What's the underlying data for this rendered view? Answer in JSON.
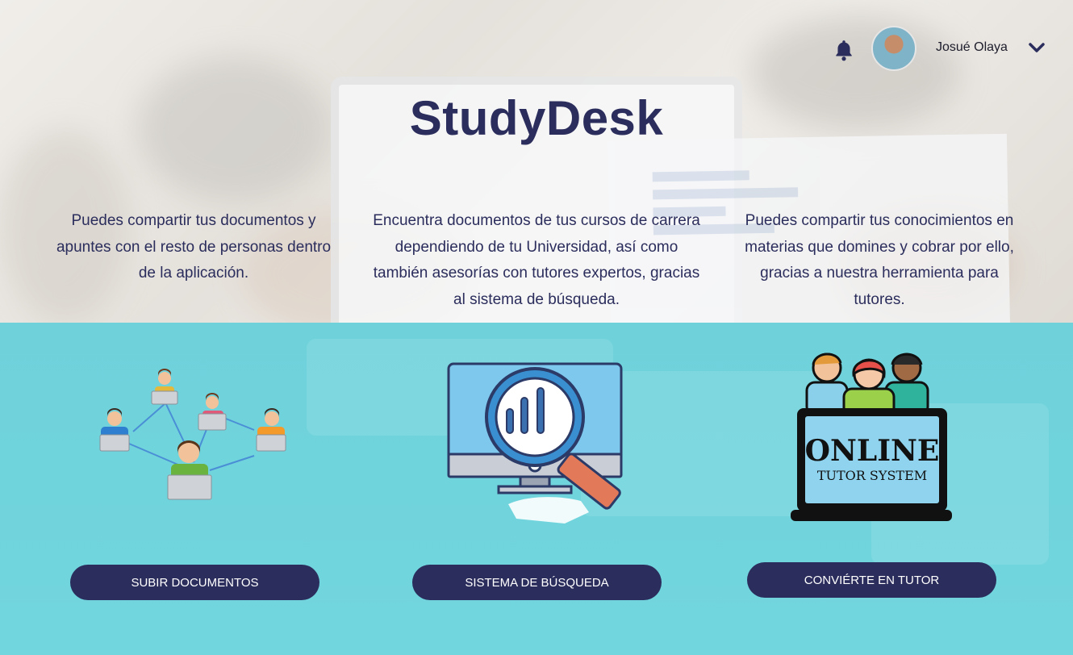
{
  "header": {
    "user_name": "Josué Olaya",
    "notification_icon": "bell-icon",
    "menu_icon": "chevron-down-icon"
  },
  "hero": {
    "title": "StudyDesk"
  },
  "features": [
    {
      "description": "Puedes compartir tus documentos y apuntes con el resto de personas dentro de la aplicación.",
      "button_label": "SUBIR DOCUMENTOS"
    },
    {
      "description": "Encuentra documentos de tus cursos de carrera dependiendo de tu Universidad, así como también asesorías con tutores expertos, gracias al sistema de búsqueda.",
      "button_label": "SISTEMA DE BÚSQUEDA"
    },
    {
      "description": "Puedes compartir tus conocimientos en materias que domines y cobrar por ello, gracias a nuestra herramienta para tutores.",
      "button_label": "CONVIÉRTE EN TUTOR"
    }
  ],
  "illustrations": {
    "tutor_title": "ONLINE",
    "tutor_subtitle": "TUTOR SYSTEM"
  },
  "colors": {
    "primary": "#2b2d5c",
    "teal": "#72d6de",
    "text": "#2b2d5c"
  }
}
